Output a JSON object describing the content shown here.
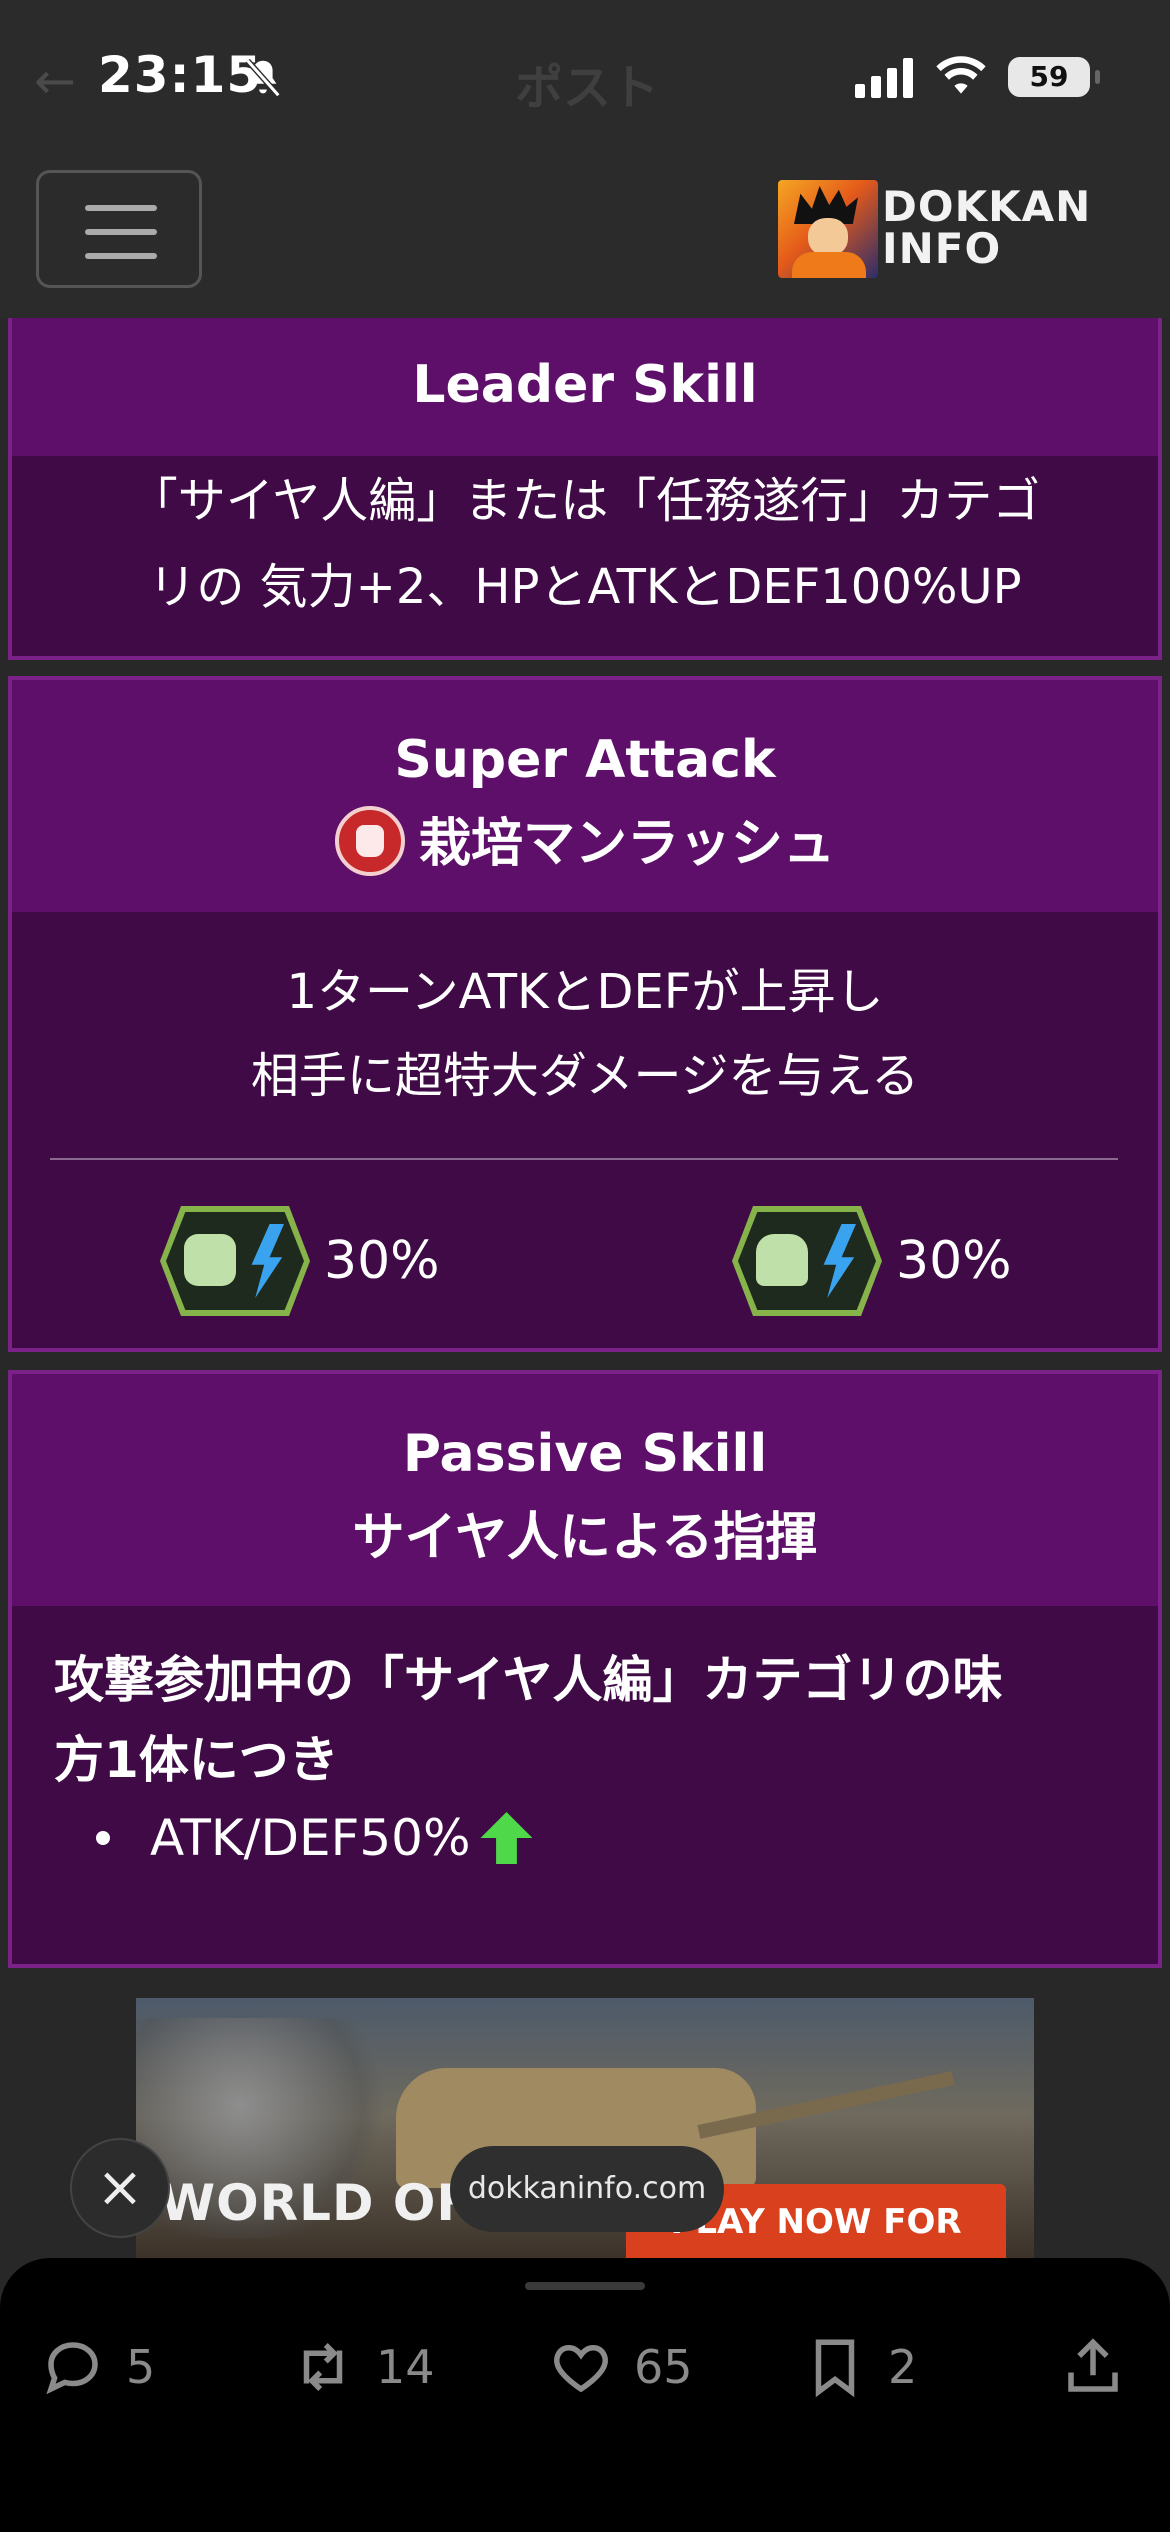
{
  "status_bar": {
    "time": "23:15",
    "battery": "59",
    "ghost_back": "←",
    "ghost_title": "ポスト"
  },
  "header": {
    "logo_text_line1": "DOKKAN",
    "logo_text_line2": "INFO"
  },
  "leader_skill": {
    "title": "Leader Skill",
    "line1": "「サイヤ人編」または「任務遂行」カテゴ",
    "line2": "リの 気力+2、HPとATKとDEF100%UP"
  },
  "super_attack": {
    "title": "Super Attack",
    "name": "栽培マンラッシュ",
    "line1": "1ターンATKとDEFが上昇し",
    "line2": "相手に超特大ダメージを与える",
    "buffs": [
      {
        "icon": "atk-up-icon",
        "value": "30%"
      },
      {
        "icon": "def-up-icon",
        "value": "30%"
      }
    ]
  },
  "passive_skill": {
    "title": "Passive Skill",
    "name": "サイヤ人による指揮",
    "line1": "攻撃参加中の「サイヤ人編」カテゴリの味",
    "line2": "方1体につき",
    "bullet": "ATK/DEF50%"
  },
  "ad": {
    "brand": "WORLD OF TANKS",
    "cta": "PLAY NOW FOR FREE",
    "close": "×"
  },
  "domain": "dokkaninfo.com",
  "actions": {
    "replies": "5",
    "reposts": "14",
    "likes": "65",
    "bookmarks": "2"
  },
  "colors": {
    "card_bg": "#3f0a45",
    "card_head": "#5e0f6a",
    "card_border": "#7b2288",
    "up_arrow": "#4fd84a"
  }
}
